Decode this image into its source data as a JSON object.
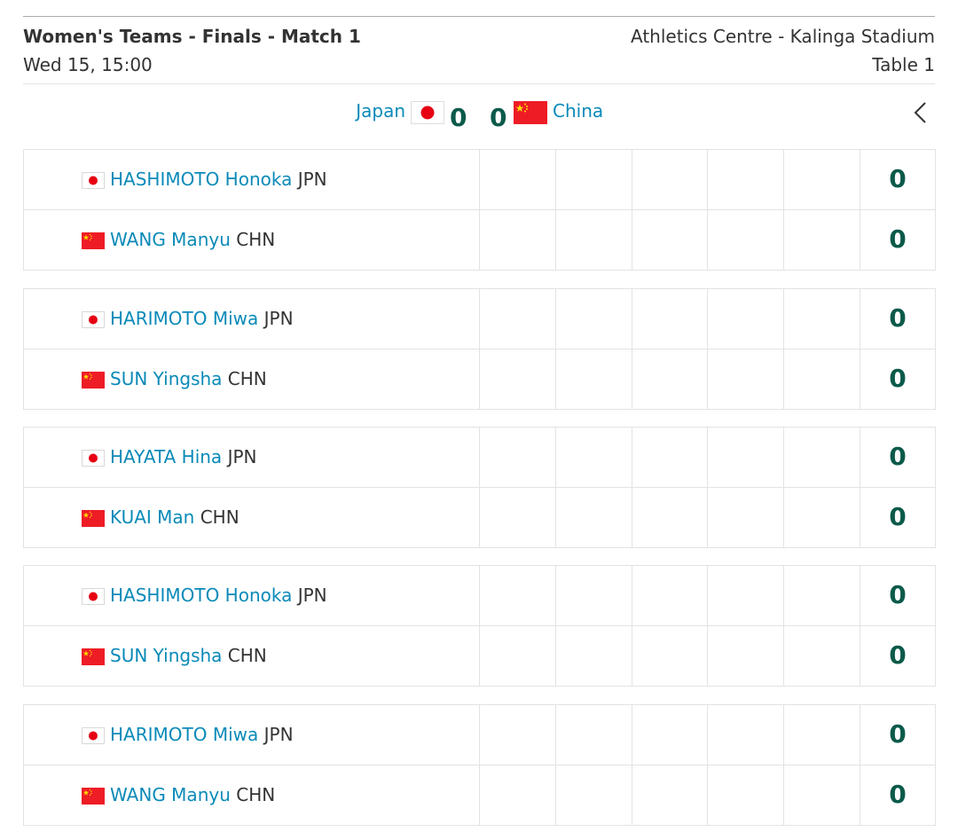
{
  "header": {
    "title": "Women's Teams - Finals - Match 1",
    "datetime": "Wed 15, 15:00",
    "venue": "Athletics Centre - Kalinga Stadium",
    "table": "Table 1"
  },
  "scoreboard": {
    "home_team": "Japan",
    "home_score": "0",
    "away_team": "China",
    "away_score": "0",
    "back_icon": "chevron-left-icon"
  },
  "games": [
    {
      "home": {
        "name": "HASHIMOTO Honoka",
        "country": "JPN",
        "score": "0",
        "flag": "japan-flag-icon"
      },
      "away": {
        "name": "WANG Manyu",
        "country": "CHN",
        "score": "0",
        "flag": "china-flag-icon"
      }
    },
    {
      "home": {
        "name": "HARIMOTO Miwa",
        "country": "JPN",
        "score": "0",
        "flag": "japan-flag-icon"
      },
      "away": {
        "name": "SUN Yingsha",
        "country": "CHN",
        "score": "0",
        "flag": "china-flag-icon"
      }
    },
    {
      "home": {
        "name": "HAYATA Hina",
        "country": "JPN",
        "score": "0",
        "flag": "japan-flag-icon"
      },
      "away": {
        "name": "KUAI Man",
        "country": "CHN",
        "score": "0",
        "flag": "china-flag-icon"
      }
    },
    {
      "home": {
        "name": "HASHIMOTO Honoka",
        "country": "JPN",
        "score": "0",
        "flag": "japan-flag-icon"
      },
      "away": {
        "name": "SUN Yingsha",
        "country": "CHN",
        "score": "0",
        "flag": "china-flag-icon"
      }
    },
    {
      "home": {
        "name": "HARIMOTO Miwa",
        "country": "JPN",
        "score": "0",
        "flag": "japan-flag-icon"
      },
      "away": {
        "name": "WANG Manyu",
        "country": "CHN",
        "score": "0",
        "flag": "china-flag-icon"
      }
    }
  ],
  "colors": {
    "link": "#0a8ab8",
    "score": "#0b5a4a",
    "japan_red": "#e60012",
    "china_red": "#ee1c25",
    "china_star": "#ffde00"
  }
}
